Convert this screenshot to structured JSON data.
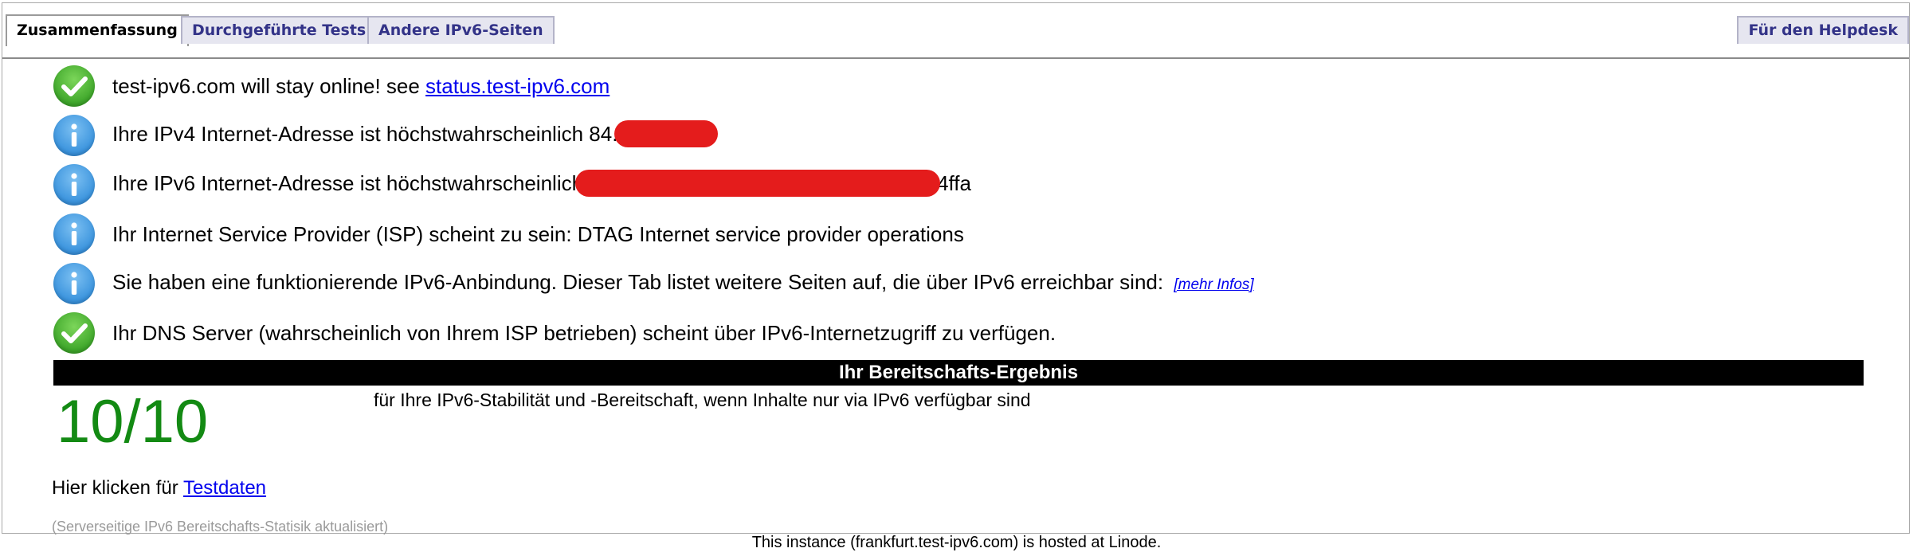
{
  "tabs": {
    "summary": "Zusammenfassung",
    "tests": "Durchgeführte Tests",
    "other": "Andere IPv6-Seiten",
    "helpdesk": "Für den Helpdesk"
  },
  "rows": {
    "r1": {
      "icon": "check-icon",
      "text": "test-ipv6.com will stay online! see ",
      "link": "status.test-ipv6.com"
    },
    "r2": {
      "icon": "info-icon",
      "text": "Ihre IPv4 Internet-Adresse ist höchstwahrscheinlich 84."
    },
    "r3": {
      "icon": "info-icon",
      "text_before": "Ihre IPv6 Internet-Adresse ist höchstwahrscheinlich",
      "text_after": "4ffa"
    },
    "r4": {
      "icon": "info-icon",
      "text": "Ihr Internet Service Provider (ISP) scheint zu sein: DTAG Internet service provider operations"
    },
    "r5": {
      "icon": "info-icon",
      "text": "Sie haben eine funktionierende IPv6-Anbindung. Dieser Tab listet weitere Seiten auf, die über IPv6 erreichbar sind: ",
      "link": "[mehr Infos]"
    },
    "r6": {
      "icon": "check-icon",
      "text": "Ihr DNS Server (wahrscheinlich von Ihrem ISP betrieben) scheint über IPv6-Internetzugriff zu verfügen."
    }
  },
  "result": {
    "title": "Ihr Bereitschafts-Ergebnis",
    "score": "10/10",
    "description": "für Ihre IPv6-Stabilität und -Bereitschaft, wenn Inhalte nur via IPv6 verfügbar sind"
  },
  "testdata": {
    "prefix": "Hier klicken für ",
    "link": "Testdaten"
  },
  "server_note": "(Serverseitige IPv6 Bereitschafts-Statisik aktualisiert)",
  "footer": "This instance (frankfurt.test-ipv6.com) is hosted at Linode.",
  "colors": {
    "score": "#138a13",
    "redaction": "#e41c1c",
    "result_bar": "#000000"
  }
}
